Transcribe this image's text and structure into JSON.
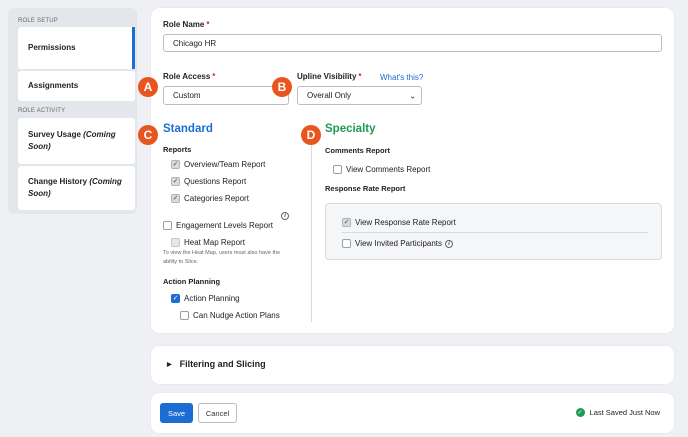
{
  "sidebar": {
    "section_setup": "ROLE SETUP",
    "permissions": "Permissions",
    "assignments": "Assignments",
    "section_activity": "ROLE ACTIVITY",
    "survey_usage": "Survey Usage",
    "survey_usage_suffix": "(Coming Soon)",
    "change_history": "Change History",
    "change_history_suffix": "(Coming Soon)"
  },
  "form": {
    "role_name_label": "Role Name",
    "required_mark": "*",
    "role_name_value": "Chicago HR",
    "role_access_label": "Role Access",
    "role_access_value": "Custom",
    "upline_label": "Upline Visibility",
    "whats_this": "What's this?",
    "upline_value": "Overall Only"
  },
  "markers": {
    "a": "A",
    "b": "B",
    "c": "C",
    "d": "D"
  },
  "standard": {
    "heading": "Standard",
    "reports_label": "Reports",
    "overview": "Overview/Team Report",
    "questions": "Questions Report",
    "categories": "Categories Report",
    "engagement": "Engagement Levels Report",
    "heatmap": "Heat Map Report",
    "heatmap_note": "To view the Heat Map, users must also have the ability to Slice.",
    "action_planning_label": "Action Planning",
    "action_planning": "Action Planning",
    "nudge": "Can Nudge Action Plans"
  },
  "specialty": {
    "heading": "Specialty",
    "comments_label": "Comments Report",
    "view_comments": "View Comments Report",
    "response_label": "Response Rate Report",
    "view_response": "View Response Rate Report",
    "view_invited": "View Invited Participants"
  },
  "info_glyph": "i",
  "check_glyph": "✓",
  "filtering": {
    "label": "Filtering and Slicing"
  },
  "footer": {
    "save": "Save",
    "cancel": "Cancel",
    "status": "Last Saved Just Now"
  },
  "colors": {
    "accent_blue": "#1b6dd4",
    "specialty_green": "#1f9a55",
    "marker_orange": "#e8551f",
    "required_red": "#d6281f"
  }
}
